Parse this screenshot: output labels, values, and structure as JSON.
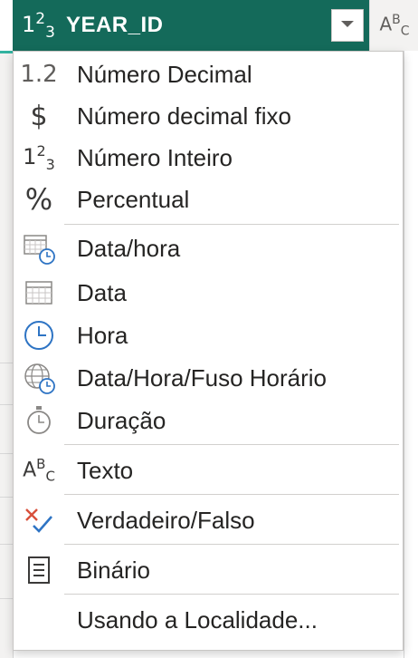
{
  "header": {
    "column_name": "YEAR_ID",
    "type_icon": "whole-number-icon",
    "dropdown_icon": "chevron-down-icon",
    "next_column_icon": "text-type-icon"
  },
  "menu": {
    "items": [
      {
        "label": "Número Decimal",
        "icon": "decimal-number-icon"
      },
      {
        "label": "Número decimal fixo",
        "icon": "dollar-icon"
      },
      {
        "label": "Número Inteiro",
        "icon": "whole-number-icon"
      },
      {
        "label": "Percentual",
        "icon": "percent-icon"
      },
      {
        "label": "Data/hora",
        "icon": "datetime-icon"
      },
      {
        "label": "Data",
        "icon": "calendar-icon"
      },
      {
        "label": "Hora",
        "icon": "clock-icon"
      },
      {
        "label": "Data/Hora/Fuso Horário",
        "icon": "globe-clock-icon"
      },
      {
        "label": "Duração",
        "icon": "stopwatch-icon"
      },
      {
        "label": "Texto",
        "icon": "text-type-icon"
      },
      {
        "label": "Verdadeiro/Falso",
        "icon": "true-false-icon"
      },
      {
        "label": "Binário",
        "icon": "binary-icon"
      },
      {
        "label": "Usando a Localidade...",
        "icon": ""
      }
    ]
  },
  "colors": {
    "header_bg": "#146a5a",
    "accent_teal": "#33b3a0",
    "menu_border": "#c8c6c4",
    "clock_blue": "#2e74c4",
    "check_blue": "#2e74c4",
    "x_red": "#d8503b"
  }
}
